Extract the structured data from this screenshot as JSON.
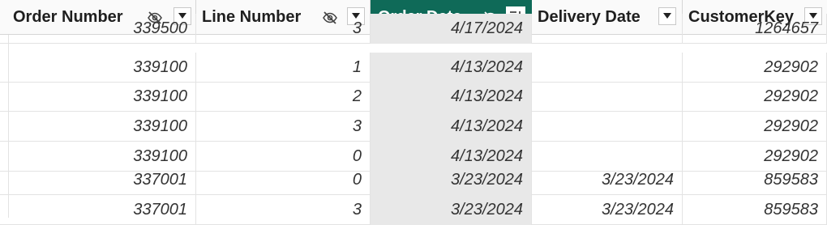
{
  "columns": [
    {
      "label": "Order Number",
      "hidden_icon": "eye-slash-icon",
      "menu_icon": "caret-down-icon",
      "selected": false
    },
    {
      "label": "Line Number",
      "hidden_icon": "eye-slash-icon",
      "menu_icon": "caret-down-icon",
      "selected": false
    },
    {
      "label": "Order Date",
      "hidden_icon": "eye-slash-icon",
      "menu_icon": "sort-icon",
      "selected": true
    },
    {
      "label": "Delivery Date",
      "menu_icon": "caret-down-icon",
      "selected": false
    },
    {
      "label": "CustomerKey",
      "menu_icon": "caret-down-icon",
      "selected": false
    }
  ],
  "rows": [
    [
      "339500",
      "3",
      "4/17/2024",
      "",
      "1264657"
    ],
    [
      "339100",
      "1",
      "4/13/2024",
      "",
      "292902"
    ],
    [
      "339100",
      "2",
      "4/13/2024",
      "",
      "292902"
    ],
    [
      "339100",
      "3",
      "4/13/2024",
      "",
      "292902"
    ],
    [
      "339100",
      "0",
      "4/13/2024",
      "",
      "292902"
    ],
    [
      "337001",
      "0",
      "3/23/2024",
      "3/23/2024",
      "859583"
    ],
    [
      "337001",
      "3",
      "3/23/2024",
      "3/23/2024",
      "859583"
    ]
  ],
  "colors": {
    "selected_header": "#0f6a58",
    "selected_column_bg": "#e8e8e8"
  }
}
